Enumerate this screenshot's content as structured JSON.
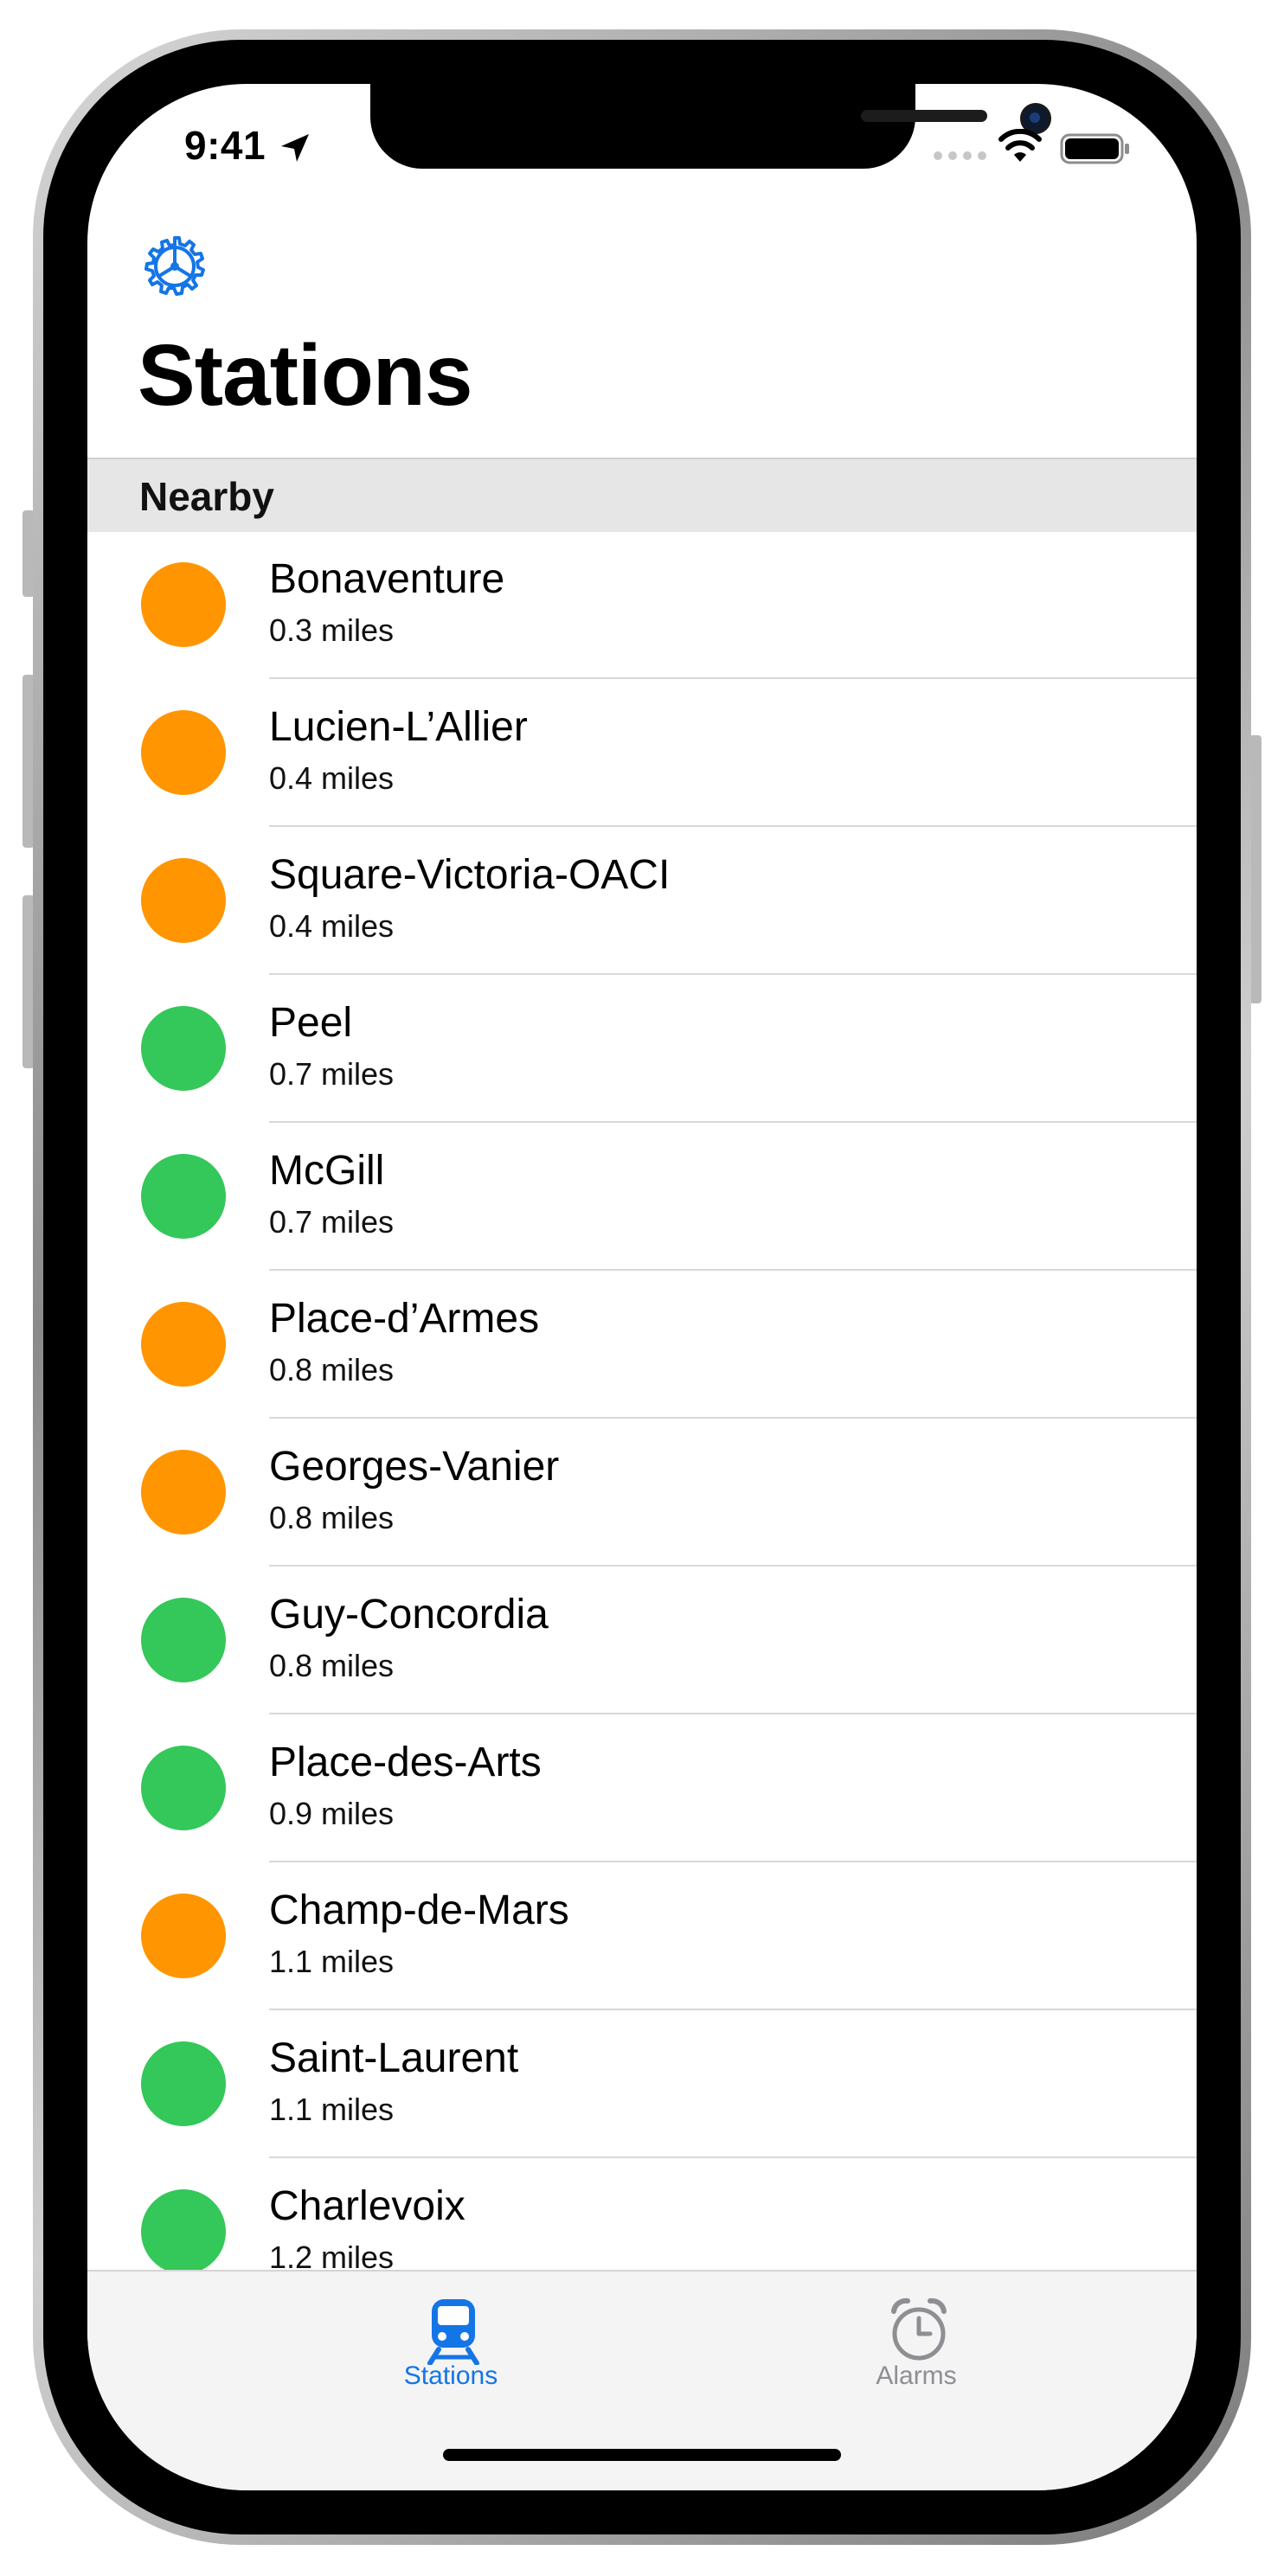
{
  "status_bar": {
    "time": "9:41"
  },
  "header": {
    "title": "Stations"
  },
  "section": {
    "title": "Nearby"
  },
  "colors": {
    "orange_line": "#FF9500",
    "green_line": "#34C759",
    "accent": "#1475E6",
    "inactive": "#8E8E93"
  },
  "stations": [
    {
      "name": "Bonaventure",
      "distance": "0.3 miles",
      "line": "orange"
    },
    {
      "name": "Lucien-L’Allier",
      "distance": "0.4 miles",
      "line": "orange"
    },
    {
      "name": "Square-Victoria-OACI",
      "distance": "0.4 miles",
      "line": "orange"
    },
    {
      "name": "Peel",
      "distance": "0.7 miles",
      "line": "green"
    },
    {
      "name": "McGill",
      "distance": "0.7 miles",
      "line": "green"
    },
    {
      "name": "Place-d’Armes",
      "distance": "0.8 miles",
      "line": "orange"
    },
    {
      "name": "Georges-Vanier",
      "distance": "0.8 miles",
      "line": "orange"
    },
    {
      "name": "Guy-Concordia",
      "distance": "0.8 miles",
      "line": "green"
    },
    {
      "name": "Place-des-Arts",
      "distance": "0.9 miles",
      "line": "green"
    },
    {
      "name": "Champ-de-Mars",
      "distance": "1.1 miles",
      "line": "orange"
    },
    {
      "name": "Saint-Laurent",
      "distance": "1.1 miles",
      "line": "green"
    },
    {
      "name": "Charlevoix",
      "distance": "1.2 miles",
      "line": "green"
    }
  ],
  "tabs": [
    {
      "label": "Stations",
      "icon": "tram-icon",
      "selected": true
    },
    {
      "label": "Alarms",
      "icon": "alarm-clock-icon",
      "selected": false
    }
  ]
}
